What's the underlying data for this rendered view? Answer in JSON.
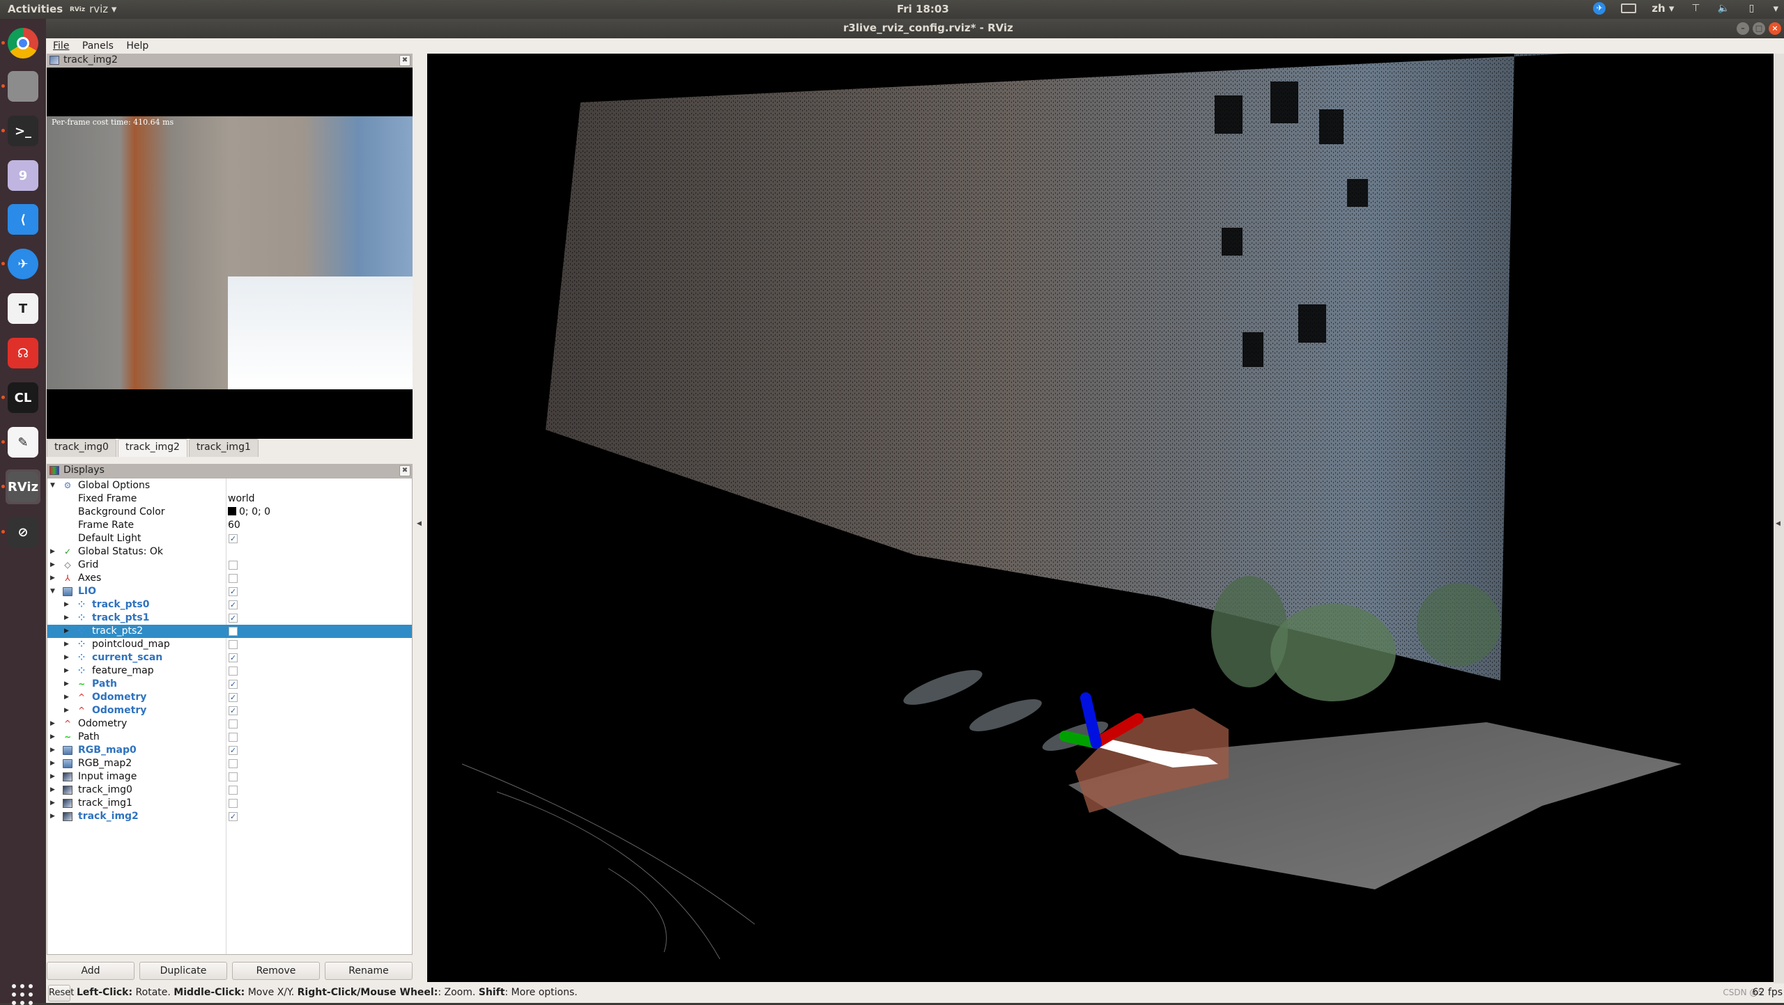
{
  "topbar": {
    "activities": "Activities",
    "app_name": "rviz",
    "app_logo": "RViz",
    "clock": "Fri 18:03",
    "tray": {
      "messenger_icon": "bird-icon",
      "keyboard_icon": "keyboard-icon",
      "input_method": "zh ▾",
      "network_icon": "network-icon",
      "volume_icon": "volume-icon",
      "battery_icon": "battery-icon",
      "menu_arrow": "▾"
    }
  },
  "window": {
    "title": "r3live_rviz_config.rviz* - RViz",
    "controls": {
      "minimize": "–",
      "maximize": "□",
      "close": "×"
    }
  },
  "dock": {
    "items": [
      {
        "name": "chrome",
        "label": "",
        "running": true,
        "color": "#4285f4"
      },
      {
        "name": "files",
        "label": "",
        "running": true,
        "color": "#8c8c8c"
      },
      {
        "name": "terminal",
        "label": ">_",
        "running": true,
        "color": "#2b2b2b"
      },
      {
        "name": "sudoku",
        "label": "9",
        "running": false,
        "color": "#bfb5e0"
      },
      {
        "name": "vscode",
        "label": "⟨",
        "running": false,
        "color": "#2a8be8"
      },
      {
        "name": "feishu",
        "label": "✈",
        "running": true,
        "color": "#2a8be8"
      },
      {
        "name": "typora",
        "label": "T",
        "running": false,
        "color": "#f2f2f2"
      },
      {
        "name": "netease-music",
        "label": "☊",
        "running": false,
        "color": "#e0302a"
      },
      {
        "name": "clion",
        "label": "CL",
        "running": true,
        "color": "#1a1a1a"
      },
      {
        "name": "text-editor",
        "label": "✎",
        "running": true,
        "color": "#f5f5f5"
      },
      {
        "name": "rviz",
        "label": "RViz",
        "running": true,
        "active": true,
        "color": "#555"
      },
      {
        "name": "recorder",
        "label": "⊘",
        "running": true,
        "color": "#333"
      }
    ],
    "show_apps_icon": "grid-dots-icon"
  },
  "menubar": {
    "items": [
      "File",
      "Panels",
      "Help"
    ]
  },
  "image_panel": {
    "title": "track_img2",
    "overlay_text": "Per-frame cost time: 410.64 ms",
    "tabs": [
      {
        "label": "track_img0",
        "selected": false
      },
      {
        "label": "track_img2",
        "selected": true
      },
      {
        "label": "track_img1",
        "selected": false
      }
    ]
  },
  "displays_panel": {
    "title": "Displays",
    "rows": [
      {
        "depth": 0,
        "expand": "▼",
        "icon": "gear",
        "label": "Global Options",
        "enabled": false
      },
      {
        "depth": 1,
        "expand": "",
        "icon": "",
        "label": "Fixed Frame",
        "value": "world"
      },
      {
        "depth": 1,
        "expand": "",
        "icon": "",
        "label": "Background Color",
        "value": "0; 0; 0",
        "swatch": "#000000"
      },
      {
        "depth": 1,
        "expand": "",
        "icon": "",
        "label": "Frame Rate",
        "value": "60"
      },
      {
        "depth": 1,
        "expand": "",
        "icon": "",
        "label": "Default Light",
        "check": true
      },
      {
        "depth": 0,
        "expand": "▶",
        "icon": "check",
        "label": "Global Status: Ok"
      },
      {
        "depth": 0,
        "expand": "▶",
        "icon": "grid",
        "label": "Grid",
        "check": false
      },
      {
        "depth": 0,
        "expand": "▶",
        "icon": "axes",
        "label": "Axes",
        "check": false
      },
      {
        "depth": 0,
        "expand": "▼",
        "icon": "folder",
        "label": "LIO",
        "check": true
      },
      {
        "depth": 1,
        "expand": "▶",
        "icon": "points",
        "label": "track_pts0",
        "check": true
      },
      {
        "depth": 1,
        "expand": "▶",
        "icon": "points",
        "label": "track_pts1",
        "check": true
      },
      {
        "depth": 1,
        "expand": "▶",
        "icon": "points",
        "label": "track_pts2",
        "check": false,
        "selected": true
      },
      {
        "depth": 1,
        "expand": "▶",
        "icon": "points",
        "label": "pointcloud_map",
        "check": false
      },
      {
        "depth": 1,
        "expand": "▶",
        "icon": "points",
        "label": "current_scan",
        "check": true
      },
      {
        "depth": 1,
        "expand": "▶",
        "icon": "points",
        "label": "feature_map",
        "check": false
      },
      {
        "depth": 1,
        "expand": "▶",
        "icon": "path",
        "label": "Path",
        "check": true
      },
      {
        "depth": 1,
        "expand": "▶",
        "icon": "odom",
        "label": "Odometry",
        "check": true
      },
      {
        "depth": 1,
        "expand": "▶",
        "icon": "odom",
        "label": "Odometry",
        "check": true
      },
      {
        "depth": 0,
        "expand": "▶",
        "icon": "odom",
        "label": "Odometry",
        "check": false
      },
      {
        "depth": 0,
        "expand": "▶",
        "icon": "path",
        "label": "Path",
        "check": false
      },
      {
        "depth": 0,
        "expand": "▶",
        "icon": "folder",
        "label": "RGB_map0",
        "check": true
      },
      {
        "depth": 0,
        "expand": "▶",
        "icon": "folder",
        "label": "RGB_map2",
        "check": false
      },
      {
        "depth": 0,
        "expand": "▶",
        "icon": "image",
        "label": "Input image",
        "check": false
      },
      {
        "depth": 0,
        "expand": "▶",
        "icon": "image",
        "label": "track_img0",
        "check": false
      },
      {
        "depth": 0,
        "expand": "▶",
        "icon": "image",
        "label": "track_img1",
        "check": false
      },
      {
        "depth": 0,
        "expand": "▶",
        "icon": "image",
        "label": "track_img2",
        "check": true
      }
    ],
    "buttons": {
      "add": "Add",
      "duplicate": "Duplicate",
      "remove": "Remove",
      "rename": "Rename"
    }
  },
  "statusbar": {
    "reset": "Reset",
    "hint": [
      {
        "b": "Left-Click:",
        "t": " Rotate. "
      },
      {
        "b": "Middle-Click:",
        "t": " Move X/Y. "
      },
      {
        "b": "Right-Click/Mouse Wheel:",
        "t": ": Zoom. "
      },
      {
        "b": "Shift",
        "t": ": More options."
      }
    ],
    "watermark": "CSDN @5",
    "fps": "62 fps"
  },
  "viewport": {
    "background": "#000000",
    "axes_colors": {
      "x": "#d10000",
      "y": "#00a000",
      "z": "#0010e0"
    },
    "path_color": "#ffffff"
  }
}
